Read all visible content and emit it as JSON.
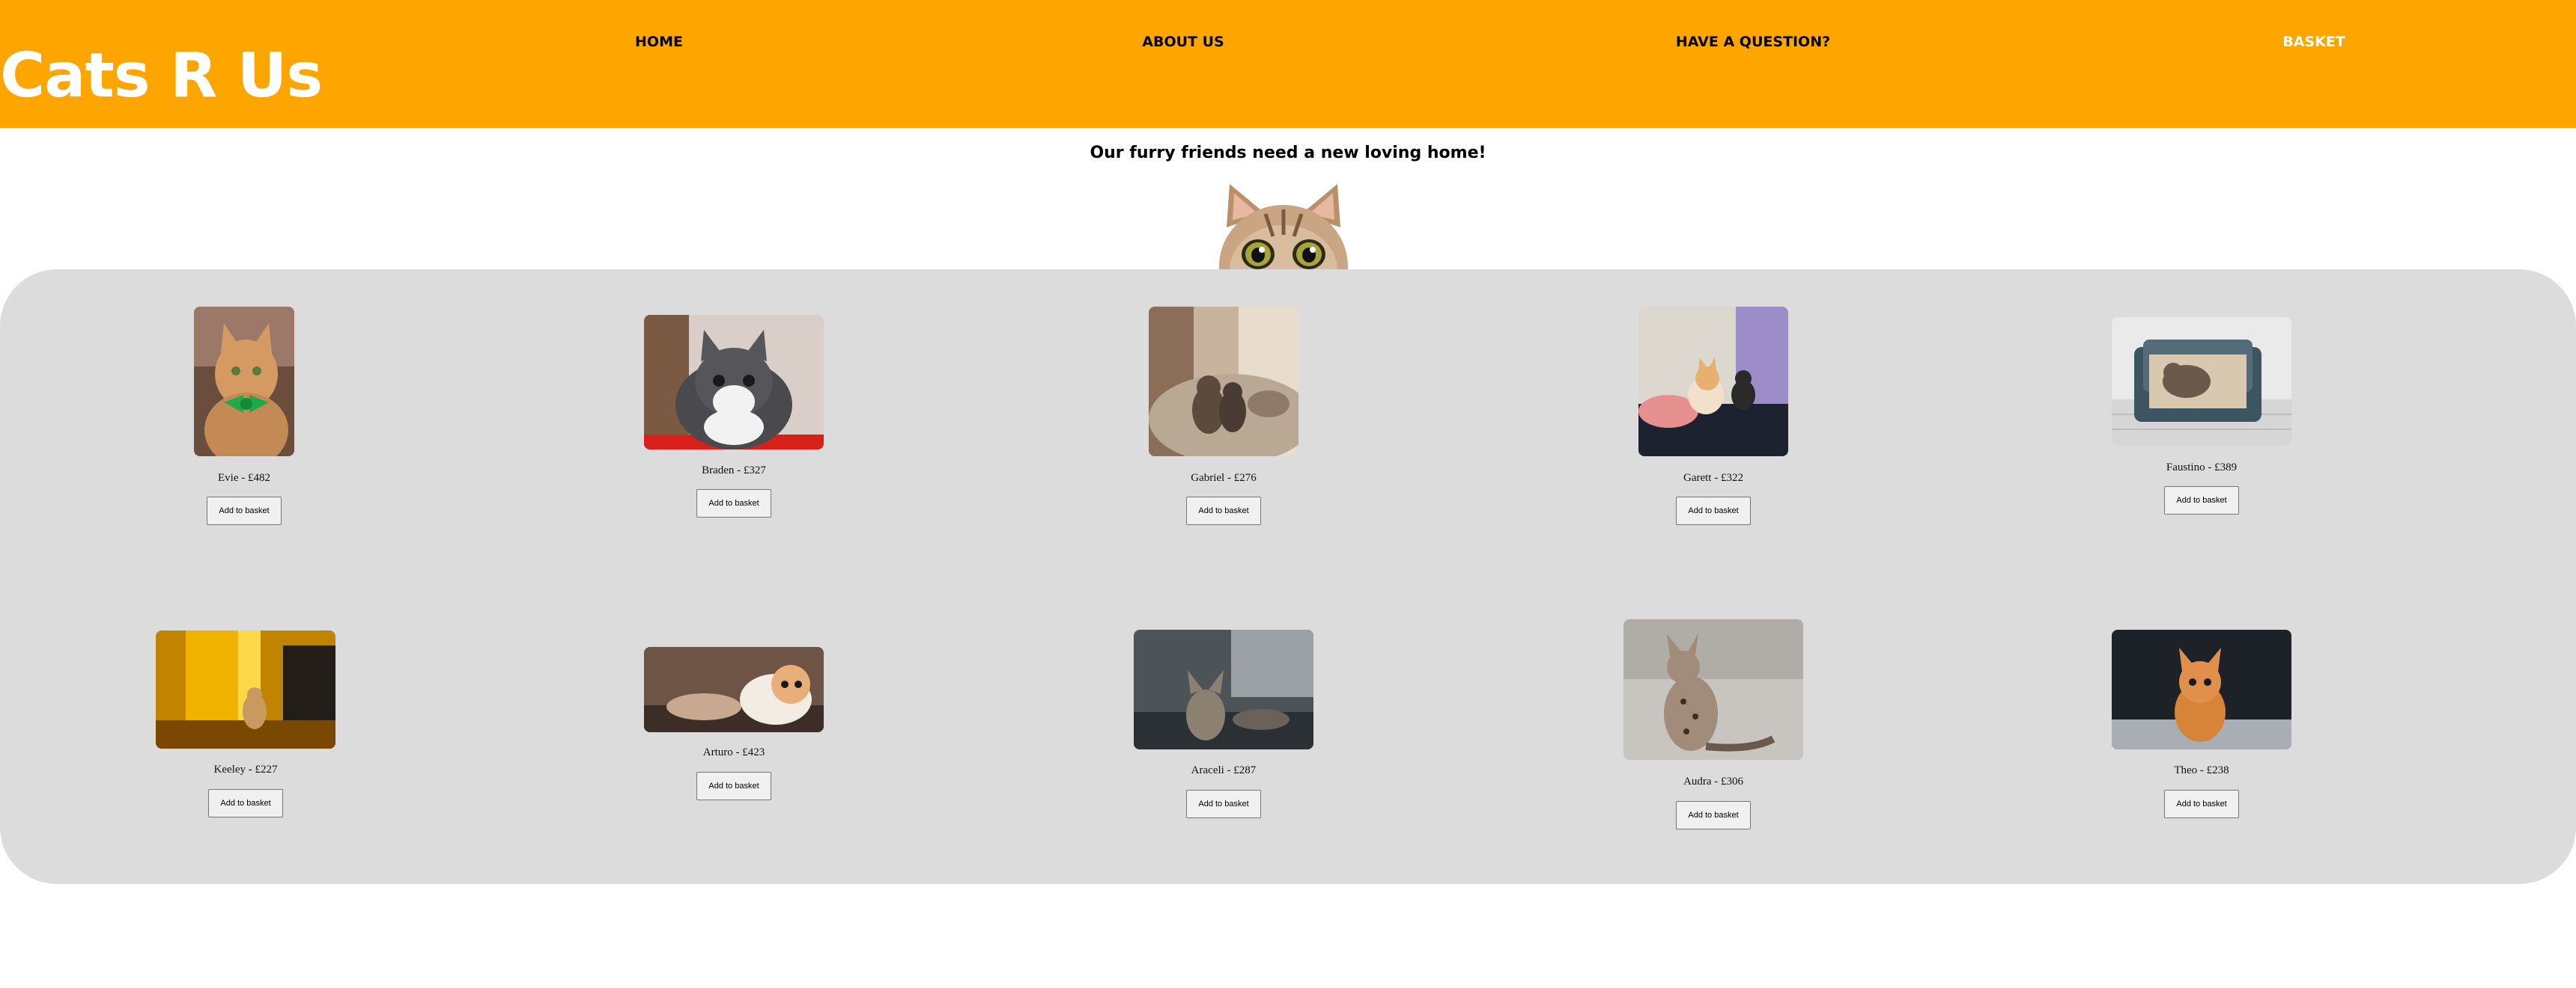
{
  "site": {
    "logo": "Cats R Us",
    "brand_color": "#FFA500"
  },
  "nav": {
    "home": "HOME",
    "about": "ABOUT US",
    "question": "HAVE A QUESTION?",
    "basket": "BASKET"
  },
  "tagline": "Our furry friends need a new loving home!",
  "add_label": "Add to basket",
  "cats": [
    {
      "caption": "Evie - £482"
    },
    {
      "caption": "Braden - £327"
    },
    {
      "caption": "Gabriel - £276"
    },
    {
      "caption": "Garett - £322"
    },
    {
      "caption": "Faustino - £389"
    },
    {
      "caption": "Keeley - £227"
    },
    {
      "caption": "Arturo - £423"
    },
    {
      "caption": "Araceli - £287"
    },
    {
      "caption": "Audra - £306"
    },
    {
      "caption": "Theo - £238"
    }
  ]
}
